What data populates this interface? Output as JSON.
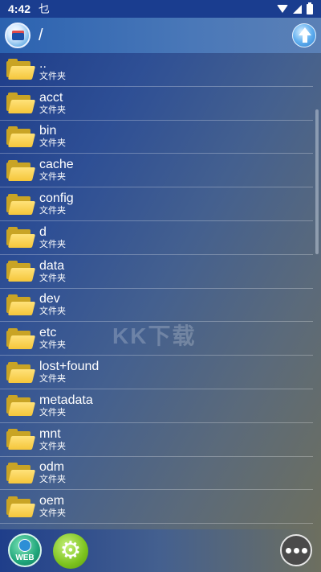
{
  "status_bar": {
    "time": "4:42",
    "notification_glyph": "乜"
  },
  "toolbar": {
    "path": "/"
  },
  "files": [
    {
      "name": "..",
      "type": "文件夹"
    },
    {
      "name": "acct",
      "type": "文件夹"
    },
    {
      "name": "bin",
      "type": "文件夹"
    },
    {
      "name": "cache",
      "type": "文件夹"
    },
    {
      "name": "config",
      "type": "文件夹"
    },
    {
      "name": "d",
      "type": "文件夹"
    },
    {
      "name": "data",
      "type": "文件夹"
    },
    {
      "name": "dev",
      "type": "文件夹"
    },
    {
      "name": "etc",
      "type": "文件夹"
    },
    {
      "name": "lost+found",
      "type": "文件夹"
    },
    {
      "name": "metadata",
      "type": "文件夹"
    },
    {
      "name": "mnt",
      "type": "文件夹"
    },
    {
      "name": "odm",
      "type": "文件夹"
    },
    {
      "name": "oem",
      "type": "文件夹"
    }
  ],
  "bottom_bar": {
    "web_label": "WEB"
  },
  "watermark": {
    "text": "KK下载"
  }
}
